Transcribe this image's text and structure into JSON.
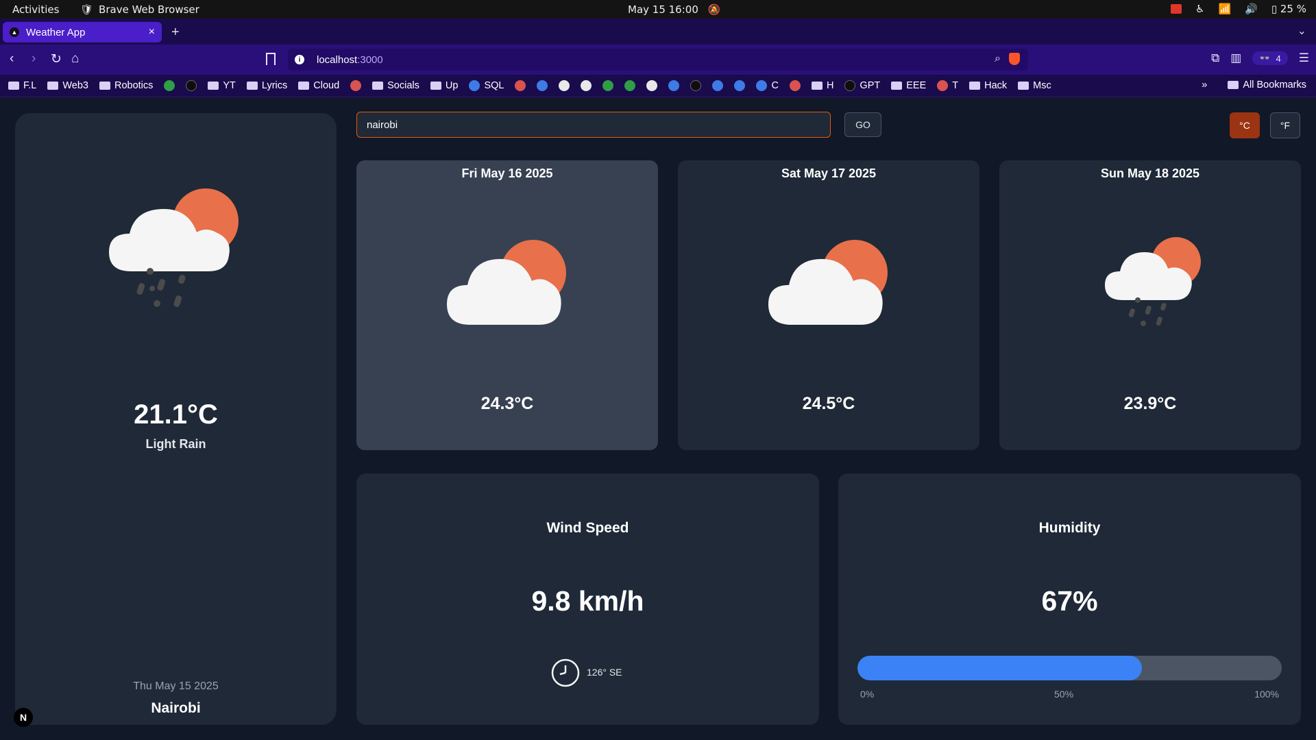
{
  "os": {
    "activities": "Activities",
    "app_name": "Brave Web Browser",
    "clock": "May 15  16:00",
    "battery": "25 %"
  },
  "browser": {
    "tab_title": "Weather App",
    "url_host": "localhost",
    "url_port": ":3000",
    "wallet_count": "4",
    "bookmarks": [
      "F.L",
      "Web3",
      "Robotics",
      "YT",
      "Lyrics",
      "Cloud",
      "Socials",
      "Up",
      "SQL",
      "GPT",
      "EEE",
      "T",
      "Hack",
      "Msc",
      "C",
      "H"
    ],
    "all_bookmarks": "All Bookmarks"
  },
  "search": {
    "value": "nairobi"
  },
  "buttons": {
    "go": "GO",
    "celsius": "°C",
    "fahrenheit": "°F"
  },
  "current": {
    "temp": "21.1°C",
    "description": "Light Rain",
    "date": "Thu May 15 2025",
    "city": "Nairobi",
    "icon": "light-rain-partly-cloudy-icon"
  },
  "forecast": [
    {
      "date": "Fri May 16 2025",
      "temp": "24.3°C",
      "icon": "partly-cloudy-icon"
    },
    {
      "date": "Sat May 17 2025",
      "temp": "24.5°C",
      "icon": "partly-cloudy-icon"
    },
    {
      "date": "Sun May 18 2025",
      "temp": "23.9°C",
      "icon": "light-rain-partly-cloudy-icon"
    }
  ],
  "wind": {
    "title": "Wind Speed",
    "value": "9.8 km/h",
    "direction": "126° SE"
  },
  "humidity": {
    "title": "Humidity",
    "value": "67%",
    "percent": 67,
    "ticks": [
      "0%",
      "50%",
      "100%"
    ]
  },
  "dev_badge": "N",
  "colors": {
    "accent": "#ea580c",
    "bar": "#3b82f6",
    "sun": "#e8704a"
  }
}
